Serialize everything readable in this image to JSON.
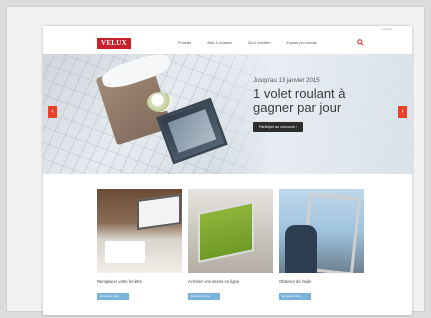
{
  "brand": {
    "logo_text": "VELUX",
    "accent": "#c8202b",
    "arrow_color": "#e8412a"
  },
  "topstrip": {
    "mini_link": "Contact"
  },
  "nav": {
    "items": [
      "Produits",
      "Aide & conseils",
      "Où & combien",
      "Espace pro monde"
    ],
    "search_icon": "search-icon"
  },
  "hero": {
    "date_text": "Jusqu'au 13 janvier 2015",
    "title_line1": "1 volet roulant à",
    "title_line2": "gagner par jour",
    "button_label": "Participer au concours  ›",
    "prev_label": "‹",
    "next_label": "›"
  },
  "cards": [
    {
      "title": "Remplacer votre fenêtre",
      "button": "En savoir plus"
    },
    {
      "title": "Achetez vos stores en ligne",
      "button": "En savoir plus"
    },
    {
      "title": "Obtenez de l'aide",
      "button": "En savoir plus"
    }
  ]
}
